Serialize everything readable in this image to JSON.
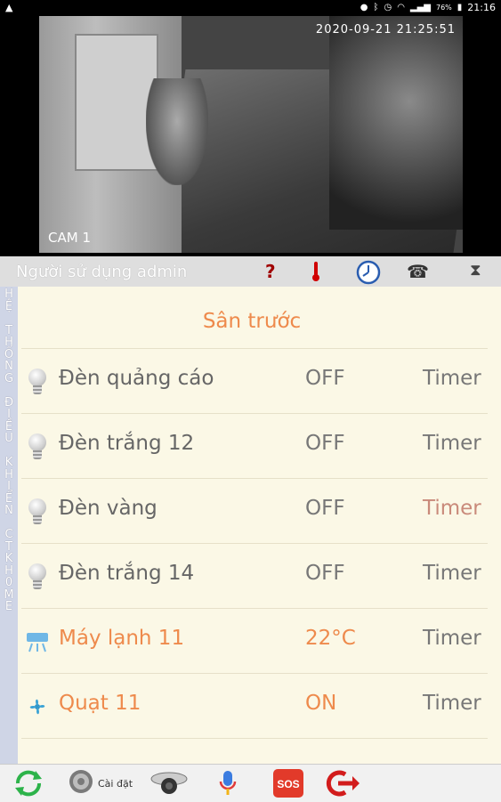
{
  "status_bar": {
    "left_icon": "warning-icon",
    "battery": "76%",
    "time": "21:16"
  },
  "camera": {
    "timestamp": "2020-09-21  21:25:51",
    "label": "CAM 1"
  },
  "header": {
    "user_label": "Người sử dụng admin",
    "icons": [
      "help-icon",
      "thermometer-icon",
      "clock-icon",
      "phone-icon",
      "hourglass-icon"
    ],
    "colors": {
      "help": "#a00000",
      "thermo": "#d00000"
    }
  },
  "sidebar": {
    "vertical_text": "HỆ THỐNG ĐIỀU KHIỂN CTKH0ME"
  },
  "main": {
    "title": "Sân trước",
    "accent_color": "#ee8a4c",
    "rows": [
      {
        "icon": "bulb-icon",
        "name": "Đèn quảng cáo",
        "state": "OFF",
        "timer": "Timer"
      },
      {
        "icon": "bulb-icon",
        "name": "Đèn trắng 12",
        "state": "OFF",
        "timer": "Timer"
      },
      {
        "icon": "bulb-icon",
        "name": "Đèn vàng",
        "state": "OFF",
        "timer": "Timer"
      },
      {
        "icon": "bulb-icon",
        "name": "Đèn trắng 14",
        "state": "OFF",
        "timer": "Timer"
      },
      {
        "icon": "air-conditioner-icon",
        "name": "Máy lạnh 11",
        "state": "22°C",
        "timer": "Timer"
      },
      {
        "icon": "fan-icon",
        "name": "Quạt 11",
        "state": "ON",
        "timer": "Timer"
      }
    ]
  },
  "toolbar": {
    "settings_label": "Cài đặt",
    "icons": [
      "refresh-icon",
      "settings-icon",
      "camera-icon",
      "microphone-icon",
      "sos-icon",
      "logout-icon"
    ],
    "sos_text": "SOS"
  }
}
